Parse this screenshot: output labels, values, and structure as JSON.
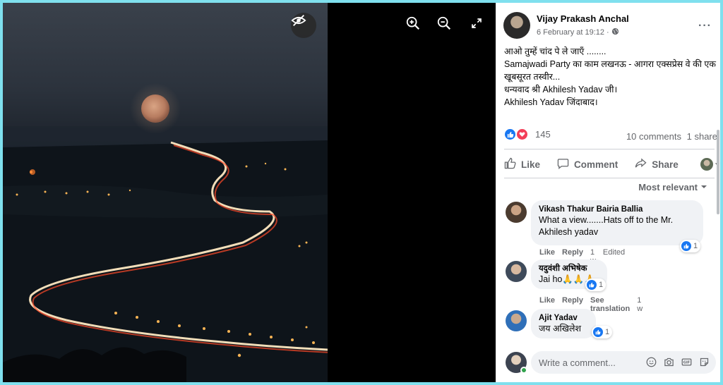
{
  "viewer": {
    "hide_icon": "eye-slash-icon",
    "zoom_in_icon": "zoom-in-icon",
    "zoom_out_icon": "zoom-out-icon",
    "fullscreen_icon": "fullscreen-icon"
  },
  "post": {
    "author": "Vijay Prakash Anchal",
    "time": "6 February at 19:12",
    "privacy_icon": "globe-icon",
    "more_label": "···",
    "text_lines": [
      "आओ तुम्हें चांद पे ले जाएँ ........",
      "Samajwadi Party का काम लखनऊ - आगरा एक्सप्रेस वे की एक खूबसूरत तस्वीर...",
      "धन्यवाद श्री Akhilesh Yadav जी।",
      "Akhilesh Yadav जिंदाबाद।"
    ],
    "reaction_count": "145",
    "comments_count": "10 comments",
    "shares_count": "1 share"
  },
  "actions": {
    "like": "Like",
    "comment": "Comment",
    "share": "Share"
  },
  "sort": {
    "label": "Most relevant"
  },
  "comments": [
    {
      "name": "Vikash Thakur Bairia Ballia",
      "text": "What a view.......Hats off to the Mr. Akhilesh yadav",
      "like": "Like",
      "reply": "Reply",
      "time": "1 w",
      "edited": "Edited",
      "reactions": "1"
    },
    {
      "name": "यदुवंशी अभिषेक",
      "text": "Jai ho🙏🙏🙏",
      "like": "Like",
      "reply": "Reply",
      "translation": "See translation",
      "time": "1 w",
      "reactions": "1"
    },
    {
      "name": "Ajit Yadav",
      "text": "जय अखिलेश",
      "reactions": "1"
    }
  ],
  "composer": {
    "placeholder": "Write a comment..."
  },
  "colors": {
    "accent": "#1877f2",
    "love": "#f33e58",
    "border": "#7fe0ee"
  }
}
